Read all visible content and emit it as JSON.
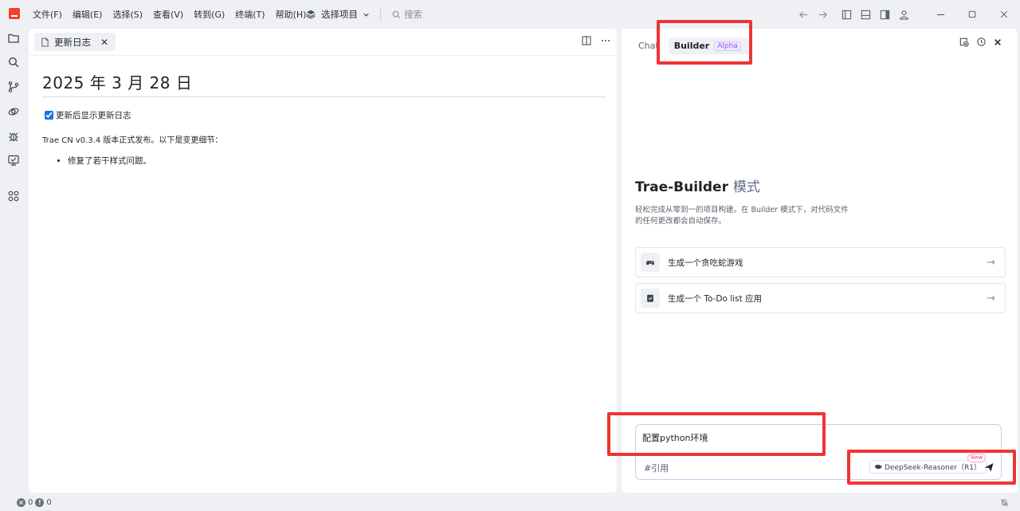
{
  "menu": [
    "文件(F)",
    "编辑(E)",
    "选择(S)",
    "查看(V)",
    "转到(G)",
    "终端(T)",
    "帮助(H)"
  ],
  "project_select": "选择项目",
  "search_placeholder": "搜索",
  "editor": {
    "tab_label": "更新日志",
    "doc_title": "2025 年 3 月 28 日",
    "checkbox_label": "更新后显示更新日志",
    "checkbox_checked": true,
    "paragraph": "Trae CN v0.3.4 版本正式发布。以下是变更细节：",
    "bullets": [
      "修复了若干样式问题。"
    ]
  },
  "side": {
    "tab_chat": "Chat",
    "tab_builder": "Builder",
    "builder_badge": "Alpha",
    "title_main": "Trae-Builder",
    "title_mode": "模式",
    "description": "轻松完成从零到一的项目构建。在 Builder 模式下，对代码文件的任何更改都会自动保存。",
    "suggestions": [
      "生成一个贪吃蛇游戏",
      "生成一个 To-Do list 应用"
    ],
    "input_value": "配置python环境",
    "cite_label": "#引用",
    "model_name": "DeepSeek-Reasoner（R1）",
    "new_badge": "New"
  },
  "status": {
    "errors": "0",
    "warnings": "0"
  },
  "colors": {
    "annotation": "#ee3434",
    "accent_logo": "#f0432c"
  }
}
